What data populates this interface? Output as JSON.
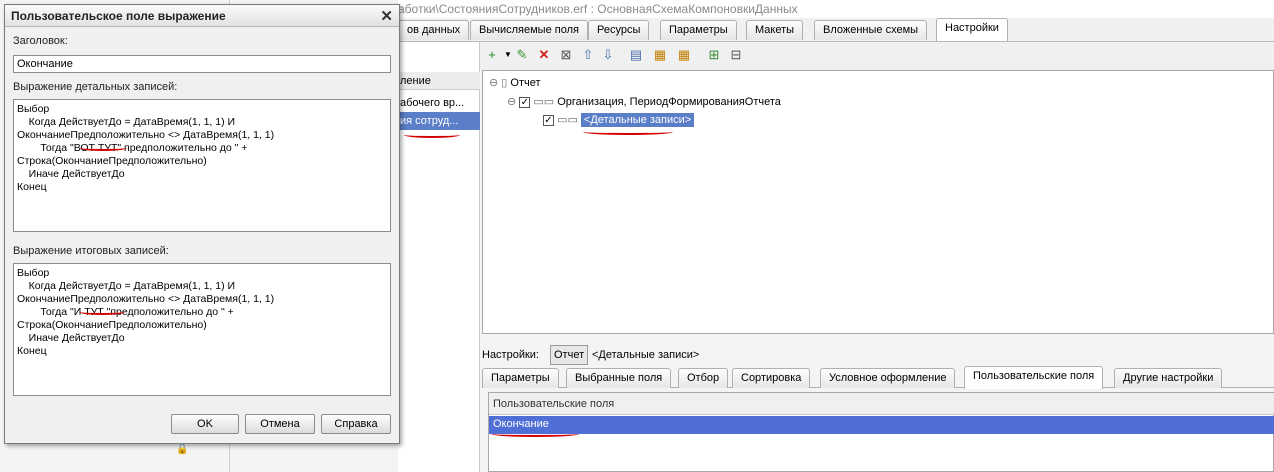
{
  "background": {
    "window_title": "аботки\\СостоянияСотрудников.erf : ОсновнаяСхемаКомпоновкиДанных",
    "tabs": [
      {
        "label": "ов данных",
        "active": false
      },
      {
        "label": "Вычисляемые поля",
        "active": false
      },
      {
        "label": "Ресурсы",
        "active": false
      },
      {
        "label": "Параметры",
        "active": false
      },
      {
        "label": "Макеты",
        "active": false
      },
      {
        "label": "Вложенные схемы",
        "active": false
      },
      {
        "label": "Настройки",
        "active": true
      }
    ],
    "left_pane": {
      "header": "ление",
      "rows": [
        "абочего вр...",
        "ия сотруд..."
      ]
    },
    "tree": {
      "root": "Отчет",
      "group": "Организация, ПериодФормированияОтчета",
      "detail": "<Детальные записи>"
    },
    "settings_bar": {
      "label": "Настройки:",
      "button": "Отчет",
      "value": "<Детальные записи>"
    },
    "settings_tabs": [
      {
        "label": "Параметры",
        "active": false
      },
      {
        "label": "Выбранные поля",
        "active": false
      },
      {
        "label": "Отбор",
        "active": false
      },
      {
        "label": "Сортировка",
        "active": false
      },
      {
        "label": "Условное оформление",
        "active": false
      },
      {
        "label": "Пользовательские поля",
        "active": true
      },
      {
        "label": "Другие настройки",
        "active": false
      }
    ],
    "user_fields": {
      "header": "Пользовательские поля",
      "rows": [
        "Окончание"
      ]
    }
  },
  "dialog": {
    "title": "Пользовательское поле выражение",
    "caption_label": "Заголовок:",
    "caption_value": "Окончание",
    "detail_label": "Выражение детальных записей:",
    "detail_expr": "Выбор\n    Когда ДействуетДо = ДатаВремя(1, 1, 1) И\nОкончаниеПредположительно <> ДатаВремя(1, 1, 1)\n        Тогда \"ВОТ ТУТ\" предположительно до \" +\nСтрока(ОкончаниеПредположительно)\n    Иначе ДействуетДо\nКонец",
    "total_label": "Выражение итоговых записей:",
    "total_expr": "Выбор\n    Когда ДействуетДо = ДатаВремя(1, 1, 1) И\nОкончаниеПредположительно <> ДатаВремя(1, 1, 1)\n        Тогда \"И ТУТ \"предположительно до \" +\nСтрока(ОкончаниеПредположительно)\n    Иначе ДействуетДо\nКонец",
    "ok": "OK",
    "cancel": "Отмена",
    "help": "Справка"
  },
  "colors": {
    "selection": "#4f6fd6",
    "annotation": "#d40000"
  }
}
